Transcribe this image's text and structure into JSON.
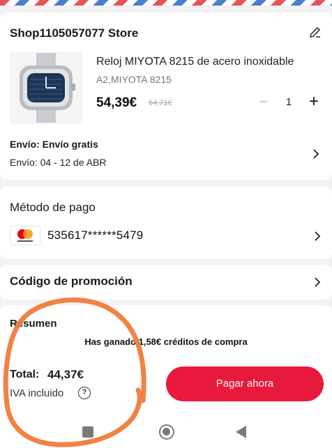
{
  "shop": {
    "name": "Shop1105057077 Store",
    "product": {
      "title": "Reloj MIYOTA 8215 de acero inoxidable",
      "variant": "A2,MIYOTA 8215",
      "price": "54,39€",
      "old_price": "64,71€",
      "quantity": "1"
    },
    "shipping": {
      "title": "Envío: Envío gratis",
      "dates": "Envío: 04 - 12 de ABR"
    }
  },
  "payment": {
    "title": "Método de pago",
    "card_number": "535617******5479"
  },
  "promo": {
    "title": "Código de promoción"
  },
  "summary": {
    "title": "Resumen",
    "credits_text": "Has ganado 1,58€ créditos de compra",
    "total_label": "Total:",
    "total_value": "44,37€",
    "vat_label": "IVA incluido",
    "pay_button": "Pagar ahora"
  },
  "colors": {
    "accent": "#e8193c",
    "annotation": "#f07a3a"
  },
  "icons": [
    "edit-icon",
    "chevron-right-icon",
    "mastercard-icon",
    "help-icon",
    "nav-recents-icon",
    "nav-home-icon",
    "nav-back-icon"
  ]
}
